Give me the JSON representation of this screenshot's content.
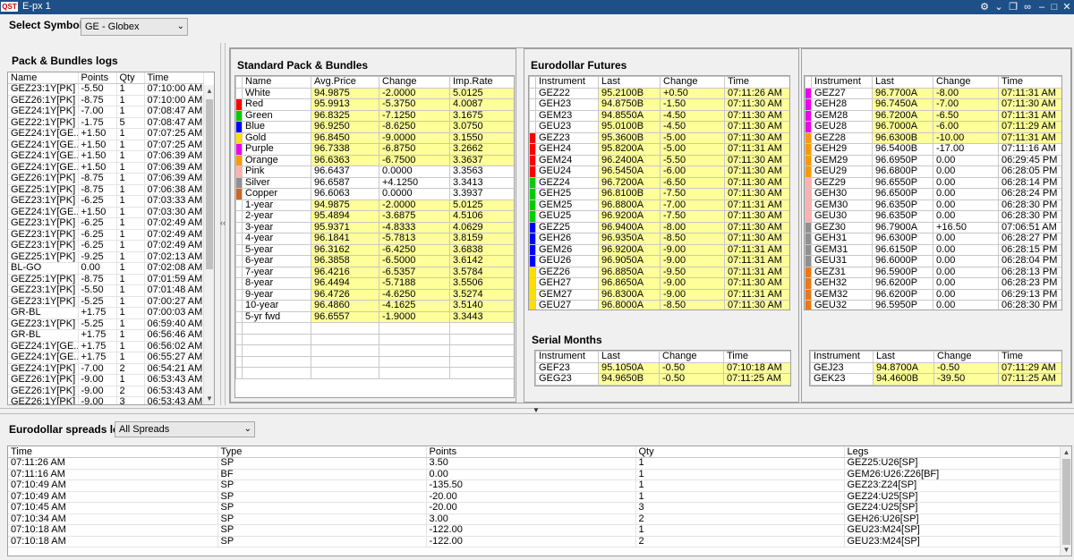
{
  "window": {
    "title": "E-px 1",
    "logo": "QST"
  },
  "symbol": {
    "label": "Select Symbol:",
    "value": "GE - Globex"
  },
  "pack_log": {
    "title": "Pack & Bundles logs",
    "columns": [
      "Name",
      "Points",
      "Qty",
      "Time"
    ],
    "rows": [
      [
        "GEZ23:1Y[PK]",
        "-5.50",
        "1",
        "07:10:00 AM"
      ],
      [
        "GEZ26:1Y[PK]",
        "-8.75",
        "1",
        "07:10:00 AM"
      ],
      [
        "GEZ24:1Y[PK]",
        "-7.00",
        "1",
        "07:08:47 AM"
      ],
      [
        "GEZ22:1Y[PK]",
        "-1.75",
        "5",
        "07:08:47 AM"
      ],
      [
        "GEZ24:1Y[GE...",
        "+1.50",
        "1",
        "07:07:25 AM"
      ],
      [
        "GEZ24:1Y[GE...",
        "+1.50",
        "1",
        "07:07:25 AM"
      ],
      [
        "GEZ24:1Y[GE...",
        "+1.50",
        "1",
        "07:06:39 AM"
      ],
      [
        "GEZ24:1Y[GE...",
        "+1.50",
        "1",
        "07:06:39 AM"
      ],
      [
        "GEZ26:1Y[PK]",
        "-8.75",
        "1",
        "07:06:39 AM"
      ],
      [
        "GEZ25:1Y[PK]",
        "-8.75",
        "1",
        "07:06:38 AM"
      ],
      [
        "GEZ23:1Y[PK]",
        "-6.25",
        "1",
        "07:03:33 AM"
      ],
      [
        "GEZ24:1Y[GE...",
        "+1.50",
        "1",
        "07:03:30 AM"
      ],
      [
        "GEZ23:1Y[PK]",
        "-6.25",
        "1",
        "07:02:49 AM"
      ],
      [
        "GEZ23:1Y[PK]",
        "-6.25",
        "1",
        "07:02:49 AM"
      ],
      [
        "GEZ23:1Y[PK]",
        "-6.25",
        "1",
        "07:02:49 AM"
      ],
      [
        "GEZ25:1Y[PK]",
        "-9.25",
        "1",
        "07:02:13 AM"
      ],
      [
        "BL-GO",
        "0.00",
        "1",
        "07:02:08 AM"
      ],
      [
        "GEZ25:1Y[PK]",
        "-8.75",
        "1",
        "07:01:59 AM"
      ],
      [
        "GEZ23:1Y[PK]",
        "-5.50",
        "1",
        "07:01:48 AM"
      ],
      [
        "GEZ23:1Y[PK]",
        "-5.25",
        "1",
        "07:00:27 AM"
      ],
      [
        "GR-BL",
        "+1.75",
        "1",
        "07:00:03 AM"
      ],
      [
        "GEZ23:1Y[PK]",
        "-5.25",
        "1",
        "06:59:40 AM"
      ],
      [
        "GR-BL",
        "+1.75",
        "1",
        "06:56:46 AM"
      ],
      [
        "GEZ24:1Y[GE...",
        "+1.75",
        "1",
        "06:56:02 AM"
      ],
      [
        "GEZ24:1Y[GE...",
        "+1.75",
        "1",
        "06:55:27 AM"
      ],
      [
        "GEZ24:1Y[PK]",
        "-7.00",
        "2",
        "06:54:21 AM"
      ],
      [
        "GEZ26:1Y[PK]",
        "-9.00",
        "1",
        "06:53:43 AM"
      ],
      [
        "GEZ26:1Y[PK]",
        "-9.00",
        "2",
        "06:53:43 AM"
      ],
      [
        "GEZ26:1Y[PK]",
        "-9.00",
        "3",
        "06:53:43 AM"
      ]
    ]
  },
  "packs": {
    "title": "Standard Pack & Bundles",
    "columns": [
      "Name",
      "Avg.Price",
      "Change",
      "Imp.Rate"
    ],
    "rows": [
      {
        "color": "#ffffff",
        "cells": [
          "White",
          "94.9875",
          "-2.0000",
          "5.0125"
        ],
        "hl": true
      },
      {
        "color": "#ff0000",
        "cells": [
          "Red",
          "95.9913",
          "-5.3750",
          "4.0087"
        ],
        "hl": true
      },
      {
        "color": "#00cc00",
        "cells": [
          "Green",
          "96.8325",
          "-7.1250",
          "3.1675"
        ],
        "hl": true
      },
      {
        "color": "#0000ff",
        "cells": [
          "Blue",
          "96.9250",
          "-8.6250",
          "3.0750"
        ],
        "hl": true
      },
      {
        "color": "#ffdd00",
        "cells": [
          "Gold",
          "96.8450",
          "-9.0000",
          "3.1550"
        ],
        "hl": true
      },
      {
        "color": "#ee00ee",
        "cells": [
          "Purple",
          "96.7338",
          "-6.8750",
          "3.2662"
        ],
        "hl": true
      },
      {
        "color": "#ff9900",
        "cells": [
          "Orange",
          "96.6363",
          "-6.7500",
          "3.3637"
        ],
        "hl": true
      },
      {
        "color": "#ffb0b0",
        "cells": [
          "Pink",
          "96.6437",
          "0.0000",
          "3.3563"
        ],
        "hl": false
      },
      {
        "color": "#909090",
        "cells": [
          "Silver",
          "96.6587",
          "+4.1250",
          "3.3413"
        ],
        "hl": false
      },
      {
        "color": "#cc6622",
        "cells": [
          "Copper",
          "96.6063",
          "0.0000",
          "3.3937"
        ],
        "hl": false
      },
      {
        "color": "#ffffff",
        "cells": [
          "1-year",
          "94.9875",
          "-2.0000",
          "5.0125"
        ],
        "hl": true
      },
      {
        "color": "#ffffff",
        "cells": [
          "2-year",
          "95.4894",
          "-3.6875",
          "4.5106"
        ],
        "hl": true
      },
      {
        "color": "#ffffff",
        "cells": [
          "3-year",
          "95.9371",
          "-4.8333",
          "4.0629"
        ],
        "hl": true
      },
      {
        "color": "#ffffff",
        "cells": [
          "4-year",
          "96.1841",
          "-5.7813",
          "3.8159"
        ],
        "hl": true
      },
      {
        "color": "#ffffff",
        "cells": [
          "5-year",
          "96.3162",
          "-6.4250",
          "3.6838"
        ],
        "hl": true
      },
      {
        "color": "#ffffff",
        "cells": [
          "6-year",
          "96.3858",
          "-6.5000",
          "3.6142"
        ],
        "hl": true
      },
      {
        "color": "#ffffff",
        "cells": [
          "7-year",
          "96.4216",
          "-6.5357",
          "3.5784"
        ],
        "hl": true
      },
      {
        "color": "#ffffff",
        "cells": [
          "8-year",
          "96.4494",
          "-5.7188",
          "3.5506"
        ],
        "hl": true
      },
      {
        "color": "#ffffff",
        "cells": [
          "9-year",
          "96.4726",
          "-4.6250",
          "3.5274"
        ],
        "hl": true
      },
      {
        "color": "#ffffff",
        "cells": [
          "10-year",
          "96.4860",
          "-4.1625",
          "3.5140"
        ],
        "hl": true
      },
      {
        "color": "#ffffff",
        "cells": [
          "5-yr fwd",
          "96.6557",
          "-1.9000",
          "3.3443"
        ],
        "hl": true
      }
    ]
  },
  "futures": {
    "title": "Eurodollar Futures",
    "columns": [
      "Instrument",
      "Last",
      "Change",
      "Time"
    ],
    "rows": [
      {
        "color": "#ffffff",
        "cells": [
          "GEZ22",
          "95.2100B",
          "+0.50",
          "07:11:26 AM"
        ]
      },
      {
        "color": "#ffffff",
        "cells": [
          "GEH23",
          "94.8750B",
          "-1.50",
          "07:11:30 AM"
        ]
      },
      {
        "color": "#ffffff",
        "cells": [
          "GEM23",
          "94.8550A",
          "-4.50",
          "07:11:30 AM"
        ]
      },
      {
        "color": "#ffffff",
        "cells": [
          "GEU23",
          "95.0100B",
          "-4.50",
          "07:11:30 AM"
        ]
      },
      {
        "color": "#ff0000",
        "cells": [
          "GEZ23",
          "95.3600B",
          "-5.00",
          "07:11:30 AM"
        ]
      },
      {
        "color": "#ff0000",
        "cells": [
          "GEH24",
          "95.8200A",
          "-5.00",
          "07:11:31 AM"
        ]
      },
      {
        "color": "#ff0000",
        "cells": [
          "GEM24",
          "96.2400A",
          "-5.50",
          "07:11:30 AM"
        ]
      },
      {
        "color": "#ff0000",
        "cells": [
          "GEU24",
          "96.5450A",
          "-6.00",
          "07:11:30 AM"
        ]
      },
      {
        "color": "#00cc00",
        "cells": [
          "GEZ24",
          "96.7200A",
          "-6.50",
          "07:11:30 AM"
        ]
      },
      {
        "color": "#00cc00",
        "cells": [
          "GEH25",
          "96.8100B",
          "-7.50",
          "07:11:30 AM"
        ]
      },
      {
        "color": "#00cc00",
        "cells": [
          "GEM25",
          "96.8800A",
          "-7.00",
          "07:11:31 AM"
        ]
      },
      {
        "color": "#00cc00",
        "cells": [
          "GEU25",
          "96.9200A",
          "-7.50",
          "07:11:30 AM"
        ]
      },
      {
        "color": "#0000ff",
        "cells": [
          "GEZ25",
          "96.9400A",
          "-8.00",
          "07:11:30 AM"
        ]
      },
      {
        "color": "#0000ff",
        "cells": [
          "GEH26",
          "96.9350A",
          "-8.50",
          "07:11:30 AM"
        ]
      },
      {
        "color": "#0000ff",
        "cells": [
          "GEM26",
          "96.9200A",
          "-9.00",
          "07:11:31 AM"
        ]
      },
      {
        "color": "#0000ff",
        "cells": [
          "GEU26",
          "96.9050A",
          "-9.00",
          "07:11:31 AM"
        ]
      },
      {
        "color": "#ffdd00",
        "cells": [
          "GEZ26",
          "96.8850A",
          "-9.50",
          "07:11:31 AM"
        ]
      },
      {
        "color": "#ffdd00",
        "cells": [
          "GEH27",
          "96.8650A",
          "-9.00",
          "07:11:30 AM"
        ]
      },
      {
        "color": "#ffdd00",
        "cells": [
          "GEM27",
          "96.8300A",
          "-9.00",
          "07:11:31 AM"
        ]
      },
      {
        "color": "#ffdd00",
        "cells": [
          "GEU27",
          "96.8000A",
          "-8.50",
          "07:11:30 AM"
        ]
      }
    ]
  },
  "futures_right": {
    "columns": [
      "Instrument",
      "Last",
      "Change",
      "Time"
    ],
    "rows": [
      {
        "color": "#ee00ee",
        "cells": [
          "GEZ27",
          "96.7700A",
          "-8.00",
          "07:11:31 AM"
        ],
        "hl": true
      },
      {
        "color": "#ee00ee",
        "cells": [
          "GEH28",
          "96.7450A",
          "-7.00",
          "07:11:30 AM"
        ],
        "hl": true
      },
      {
        "color": "#ee00ee",
        "cells": [
          "GEM28",
          "96.7200A",
          "-6.50",
          "07:11:31 AM"
        ],
        "hl": true
      },
      {
        "color": "#ee00ee",
        "cells": [
          "GEU28",
          "96.7000A",
          "-6.00",
          "07:11:29 AM"
        ],
        "hl": true
      },
      {
        "color": "#ff9900",
        "cells": [
          "GEZ28",
          "96.6300B",
          "-10.00",
          "07:11:31 AM"
        ],
        "hl": true
      },
      {
        "color": "#ff9900",
        "cells": [
          "GEH29",
          "96.5400B",
          "-17.00",
          "07:11:16 AM"
        ],
        "hl": false
      },
      {
        "color": "#ff9900",
        "cells": [
          "GEM29",
          "96.6950P",
          "0.00",
          "06:29:45 PM"
        ],
        "hl": false
      },
      {
        "color": "#ff9900",
        "cells": [
          "GEU29",
          "96.6800P",
          "0.00",
          "06:28:05 PM"
        ],
        "hl": false
      },
      {
        "color": "#ffb0b0",
        "cells": [
          "GEZ29",
          "96.6550P",
          "0.00",
          "06:28:14 PM"
        ],
        "hl": false
      },
      {
        "color": "#ffb0b0",
        "cells": [
          "GEH30",
          "96.6500P",
          "0.00",
          "06:28:24 PM"
        ],
        "hl": false
      },
      {
        "color": "#ffb0b0",
        "cells": [
          "GEM30",
          "96.6350P",
          "0.00",
          "06:28:30 PM"
        ],
        "hl": false
      },
      {
        "color": "#ffb0b0",
        "cells": [
          "GEU30",
          "96.6350P",
          "0.00",
          "06:28:30 PM"
        ],
        "hl": false
      },
      {
        "color": "#909090",
        "cells": [
          "GEZ30",
          "96.7900A",
          "+16.50",
          "07:06:51 AM"
        ],
        "hl": false
      },
      {
        "color": "#909090",
        "cells": [
          "GEH31",
          "96.6300P",
          "0.00",
          "06:28:27 PM"
        ],
        "hl": false
      },
      {
        "color": "#909090",
        "cells": [
          "GEM31",
          "96.6150P",
          "0.00",
          "06:28:15 PM"
        ],
        "hl": false
      },
      {
        "color": "#909090",
        "cells": [
          "GEU31",
          "96.6000P",
          "0.00",
          "06:28:04 PM"
        ],
        "hl": false
      },
      {
        "color": "#ee7711",
        "cells": [
          "GEZ31",
          "96.5900P",
          "0.00",
          "06:28:13 PM"
        ],
        "hl": false
      },
      {
        "color": "#ee7711",
        "cells": [
          "GEH32",
          "96.6200P",
          "0.00",
          "06:28:23 PM"
        ],
        "hl": false
      },
      {
        "color": "#ee7711",
        "cells": [
          "GEM32",
          "96.6200P",
          "0.00",
          "06:29:13 PM"
        ],
        "hl": false
      },
      {
        "color": "#ee7711",
        "cells": [
          "GEU32",
          "96.5950P",
          "0.00",
          "06:28:30 PM"
        ],
        "hl": false
      }
    ]
  },
  "serial": {
    "title": "Serial Months",
    "columns": [
      "Instrument",
      "Last",
      "Change",
      "Time"
    ],
    "rows": [
      [
        "GEF23",
        "95.1050A",
        "-0.50",
        "07:10:18 AM"
      ],
      [
        "GEG23",
        "94.9650B",
        "-0.50",
        "07:11:25 AM"
      ]
    ]
  },
  "serial_right": {
    "columns": [
      "Instrument",
      "Last",
      "Change",
      "Time"
    ],
    "rows": [
      [
        "GEJ23",
        "94.8700A",
        "-0.50",
        "07:11:29 AM"
      ],
      [
        "GEK23",
        "94.4600B",
        "-39.50",
        "07:11:25 AM"
      ]
    ]
  },
  "spreads": {
    "title": "Eurodollar spreads log",
    "filter": "All Spreads",
    "columns": [
      "Time",
      "Type",
      "Points",
      "Qty",
      "Legs"
    ],
    "rows": [
      [
        "07:11:26 AM",
        "SP",
        "3.50",
        "1",
        "GEZ25:U26[SP]"
      ],
      [
        "07:11:16 AM",
        "BF",
        "0.00",
        "1",
        "GEM26:U26:Z26[BF]"
      ],
      [
        "07:10:49 AM",
        "SP",
        "-135.50",
        "1",
        "GEZ23:Z24[SP]"
      ],
      [
        "07:10:49 AM",
        "SP",
        "-20.00",
        "1",
        "GEZ24:U25[SP]"
      ],
      [
        "07:10:45 AM",
        "SP",
        "-20.00",
        "3",
        "GEZ24:U25[SP]"
      ],
      [
        "07:10:34 AM",
        "SP",
        "3.00",
        "2",
        "GEH26:U26[SP]"
      ],
      [
        "07:10:18 AM",
        "SP",
        "-122.00",
        "1",
        "GEU23:M24[SP]"
      ],
      [
        "07:10:18 AM",
        "SP",
        "-122.00",
        "2",
        "GEU23:M24[SP]"
      ]
    ]
  }
}
